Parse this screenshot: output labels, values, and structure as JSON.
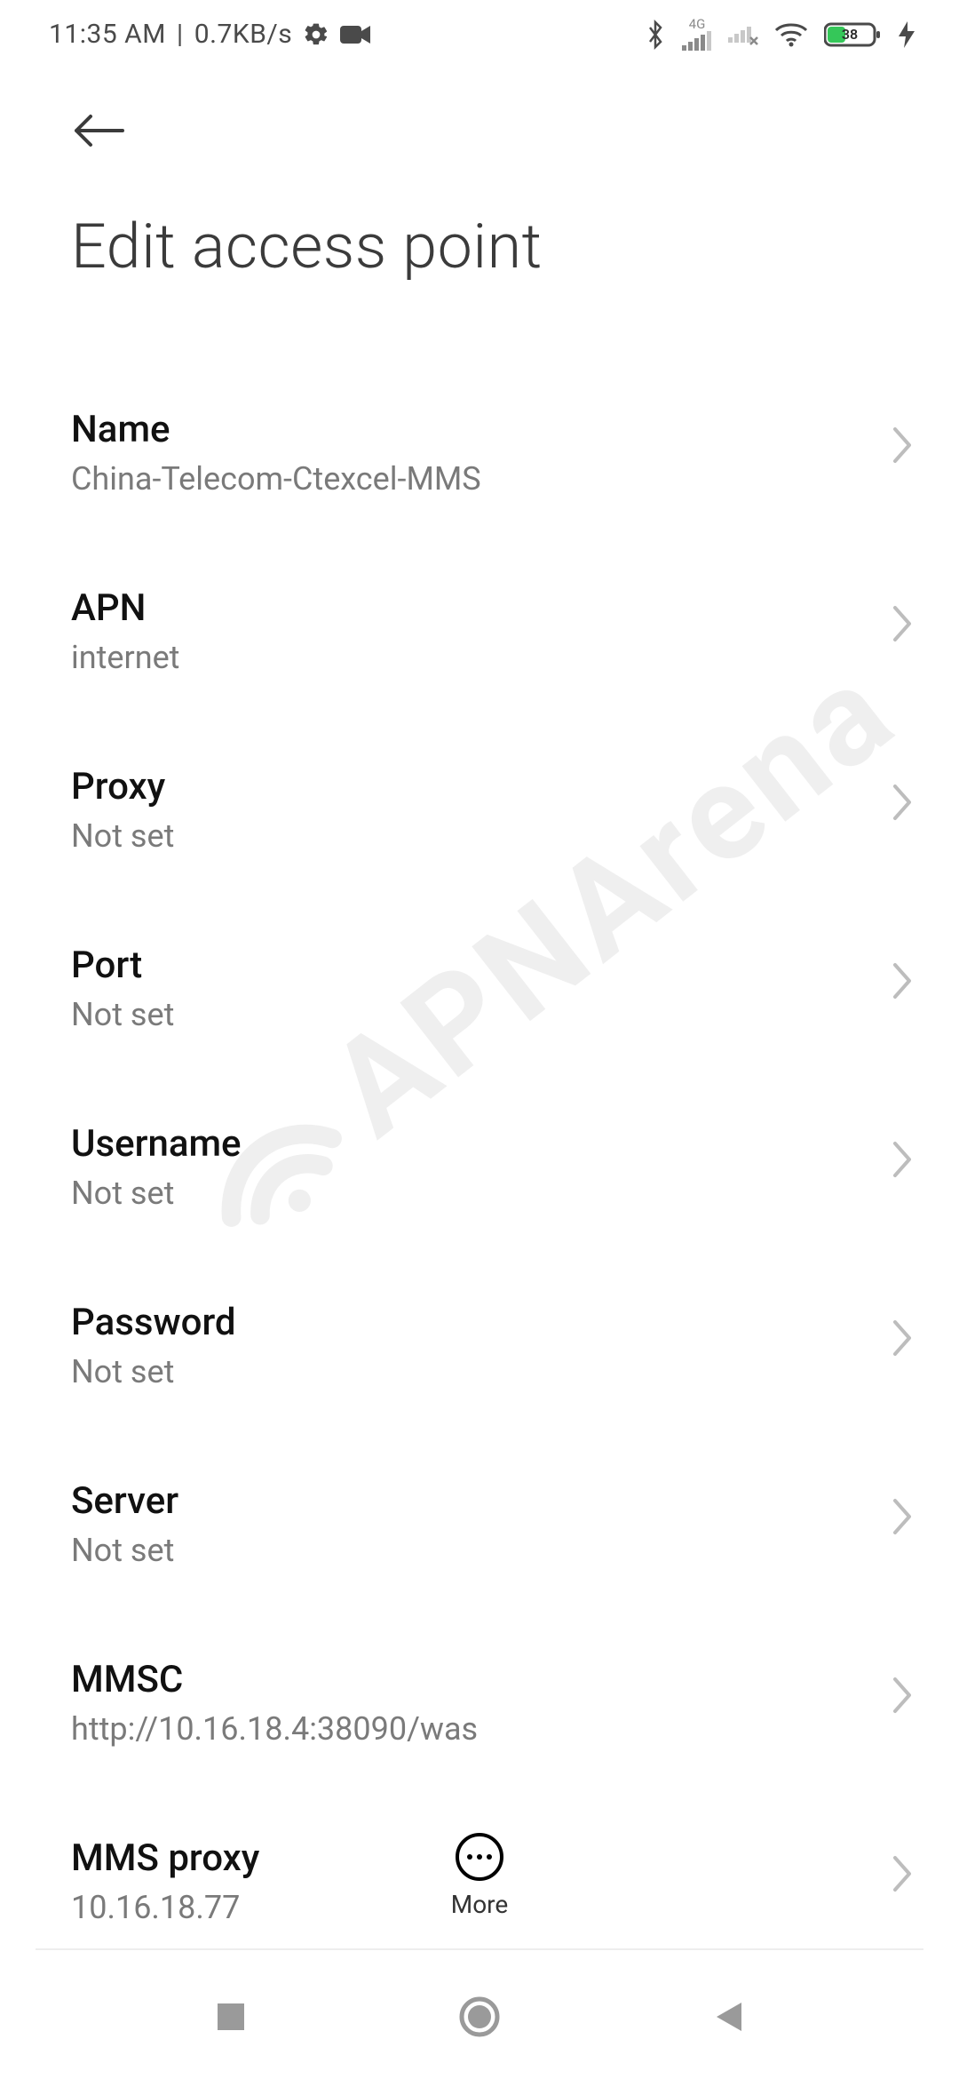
{
  "status": {
    "time": "11:35 AM",
    "sep": "|",
    "rate": "0.7KB/s",
    "net_label": "4G",
    "battery_pct": "38"
  },
  "header": {
    "title": "Edit access point"
  },
  "rows": [
    {
      "title": "Name",
      "sub": "China-Telecom-Ctexcel-MMS"
    },
    {
      "title": "APN",
      "sub": "internet"
    },
    {
      "title": "Proxy",
      "sub": "Not set"
    },
    {
      "title": "Port",
      "sub": "Not set"
    },
    {
      "title": "Username",
      "sub": "Not set"
    },
    {
      "title": "Password",
      "sub": "Not set"
    },
    {
      "title": "Server",
      "sub": "Not set"
    },
    {
      "title": "MMSC",
      "sub": "http://10.16.18.4:38090/was"
    },
    {
      "title": "MMS proxy",
      "sub": "10.16.18.77"
    }
  ],
  "more_label": "More",
  "watermark_text": "APNArena"
}
